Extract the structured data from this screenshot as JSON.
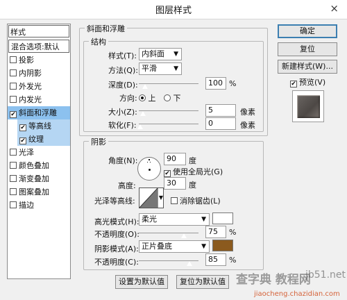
{
  "window": {
    "title": "图层样式",
    "close_icon": "×"
  },
  "left_panel": {
    "header": "样式",
    "blend": "混合选项:默认",
    "items": [
      {
        "label": "投影",
        "checked": false
      },
      {
        "label": "内阴影",
        "checked": false
      },
      {
        "label": "外发光",
        "checked": false
      },
      {
        "label": "内发光",
        "checked": false
      },
      {
        "label": "斜面和浮雕",
        "checked": true
      },
      {
        "label": "等高线",
        "checked": true
      },
      {
        "label": "纹理",
        "checked": true
      },
      {
        "label": "光泽",
        "checked": false
      },
      {
        "label": "颜色叠加",
        "checked": false
      },
      {
        "label": "渐变叠加",
        "checked": false
      },
      {
        "label": "图案叠加",
        "checked": false
      },
      {
        "label": "描边",
        "checked": false
      }
    ]
  },
  "bevel": {
    "group_title": "斜面和浮雕",
    "structure_title": "结构",
    "style_label": "样式(T):",
    "style_value": "内斜面",
    "method_label": "方法(Q):",
    "method_value": "平滑",
    "depth_label": "深度(D):",
    "depth_value": "100",
    "depth_unit": "%",
    "direction_label": "方向:",
    "dir_up": "上",
    "dir_down": "下",
    "size_label": "大小(Z):",
    "size_value": "5",
    "size_unit": "像素",
    "soften_label": "软化(F):",
    "soften_value": "0",
    "soften_unit": "像素"
  },
  "shading": {
    "title": "阴影",
    "angle_label": "角度(N):",
    "angle_value": "90",
    "angle_unit": "度",
    "global_light": "使用全局光(G)",
    "altitude_label": "高度:",
    "altitude_value": "30",
    "altitude_unit": "度",
    "gloss_label": "光泽等高线:",
    "antialias": "消除锯齿(L)",
    "highlight_mode_label": "高光模式(H):",
    "highlight_mode_value": "柔光",
    "highlight_color": "#ffffff",
    "highlight_opacity_label": "不透明度(O):",
    "highlight_opacity_value": "75",
    "shadow_mode_label": "阴影模式(A):",
    "shadow_mode_value": "正片叠底",
    "shadow_color": "#8b5a1e",
    "shadow_opacity_label": "不透明度(C):",
    "shadow_opacity_value": "85",
    "percent": "%"
  },
  "buttons": {
    "ok": "确定",
    "reset": "复位",
    "new_style": "新建样式(W)...",
    "preview": "预览(V)",
    "set_default": "设置为默认值",
    "reset_default": "复位为默认值"
  },
  "watermark": {
    "line1": "查字典 教程网",
    "site1": "jb51.net",
    "site2": "jiaocheng.chazidian.com"
  }
}
